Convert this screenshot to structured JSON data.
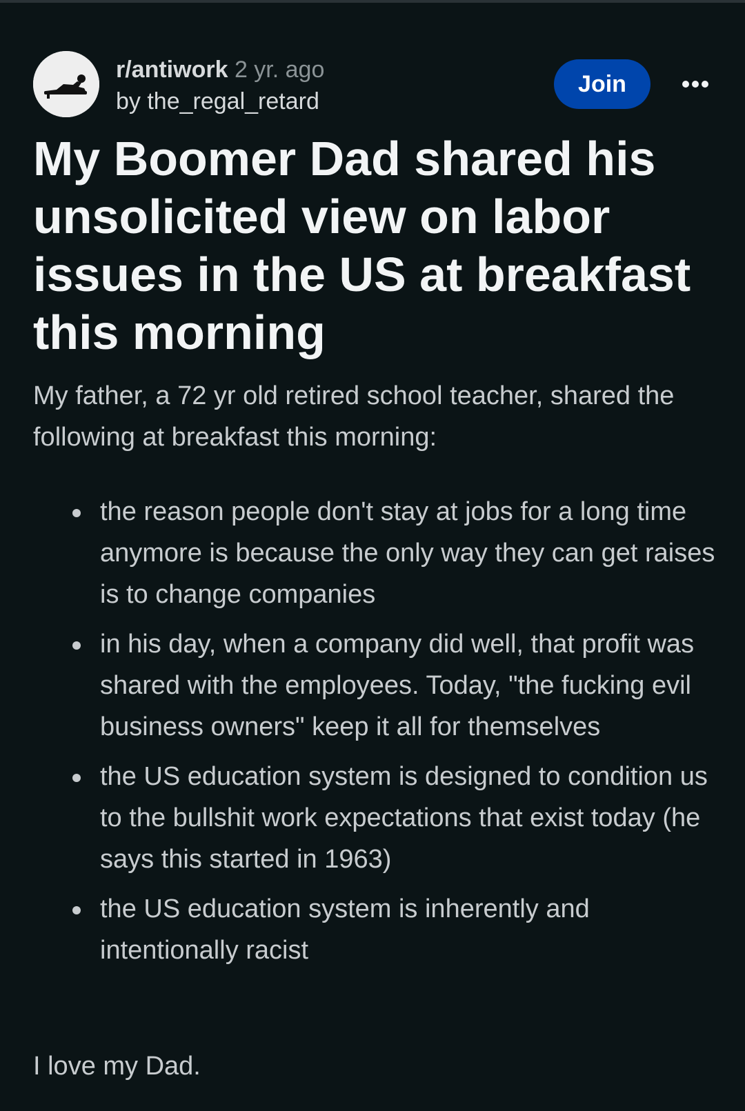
{
  "post": {
    "subreddit": "r/antiwork",
    "age": "2 yr. ago",
    "author_line": "by the_regal_retard",
    "join_label": "Join",
    "more_label": "•••",
    "title": "My Boomer Dad shared his unsolicited view on labor issues in the US at breakfast this morning",
    "intro": "My father, a 72 yr old retired school teacher, shared the following at breakfast this morning:",
    "bullets": [
      "the reason people don't stay at jobs for a long time anymore is because the only way they can get raises is to change companies",
      "in his day, when a company did well, that profit was shared with the employees. Today, \"the fucking evil business owners\" keep it all for themselves",
      "the US education system is designed to condition us to the bullshit work expectations that exist today (he says this started in 1963)",
      "the US education system is inherently and intentionally racist"
    ],
    "closing": "I love my Dad."
  },
  "colors": {
    "background": "#0b1416",
    "join_button": "#0045ac",
    "title_text": "#f2f4f5",
    "body_text": "#c8cccf",
    "muted_text": "#8b9396"
  },
  "icons": {
    "avatar": "subreddit-avatar-reclining-figure-icon",
    "more": "more-options-icon"
  }
}
